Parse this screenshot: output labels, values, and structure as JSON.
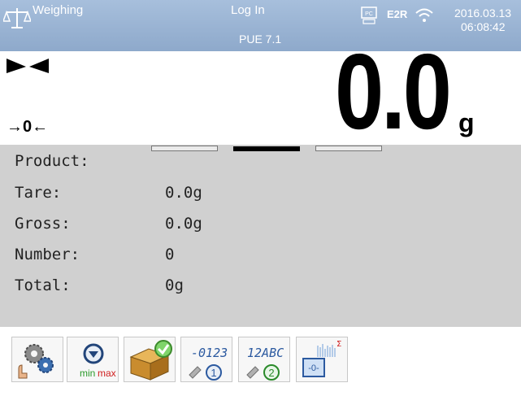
{
  "header": {
    "mode": "Weighing",
    "user": "Log In",
    "model": "PUE 7.1",
    "interface": "E2R",
    "date": "2016.03.13",
    "time": "06:08:42",
    "icons": [
      "scale-icon",
      "pc-connection-icon",
      "wifi-icon"
    ]
  },
  "display": {
    "weight": "0.0",
    "unit": "g",
    "zero_indicator": "→0←",
    "stability": "stable"
  },
  "info": [
    {
      "label": "Product:",
      "value": ""
    },
    {
      "label": "Tare:",
      "value": "0.0g"
    },
    {
      "label": "Gross:",
      "value": "0.0g"
    },
    {
      "label": "Number:",
      "value": "0"
    },
    {
      "label": "Total:",
      "value": "0g"
    }
  ],
  "toolbar": {
    "minmax_min": "min",
    "minmax_max": "max",
    "counter_label": "-0123",
    "alpha_label": "12ABC",
    "tare_label": "-0-",
    "buttons": [
      "settings-icon",
      "min-max-icon",
      "product-check-icon",
      "numeric-input-1-icon",
      "text-input-2-icon",
      "tare-zero-icon"
    ]
  },
  "colors": {
    "header_bg": "#9db6d6",
    "panel_bg": "#d0d0d0",
    "text_light": "#ffffff"
  }
}
